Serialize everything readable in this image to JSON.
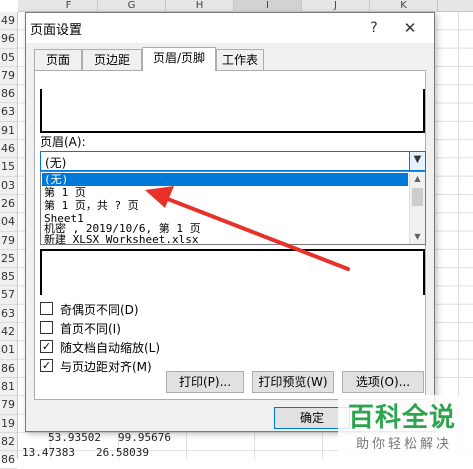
{
  "sheet": {
    "columns": [
      "F",
      "G",
      "H",
      "I",
      "J",
      "K"
    ],
    "row_numbers": [
      "49",
      "96",
      "05",
      "79",
      "86",
      "63",
      "91",
      "46",
      "15",
      "03",
      "26",
      "04",
      "79",
      "25",
      "85",
      "57",
      "63",
      "42",
      "01",
      "86",
      "81",
      "79",
      "19",
      "82",
      "86"
    ],
    "bottom_cells": [
      "53.93502",
      "99.95676",
      "13.47383",
      "26.58039"
    ]
  },
  "dialog": {
    "title": "页面设置",
    "help_glyph": "?",
    "close_glyph": "✕",
    "tabs": [
      "页面",
      "页边距",
      "页眉/页脚",
      "工作表"
    ],
    "header_label": "页眉(A):",
    "header_combo_value": "(无)",
    "header_options": [
      "(无)",
      "第 1 页",
      "第 1 页，共 ? 页",
      "Sheet1",
      " 机密 , 2019/10/6, 第 1 页",
      "新建 XLSX Worksheet.xlsx"
    ],
    "checkboxes": [
      {
        "label": "奇偶页不同(D)",
        "checked": false
      },
      {
        "label": "首页不同(I)",
        "checked": false
      },
      {
        "label": "随文档自动缩放(L)",
        "checked": true
      },
      {
        "label": "与页边距对齐(M)",
        "checked": true
      }
    ],
    "buttons": {
      "print": "打印(P)...",
      "preview": "打印预览(W)",
      "options": "选项(O)...",
      "ok": "确定"
    }
  },
  "watermark": {
    "big": "百科全说",
    "small": "助你轻松解决"
  },
  "colors": {
    "accent": "#0078d7",
    "arrow": "#e8312a",
    "watermark": "#2da44e"
  }
}
